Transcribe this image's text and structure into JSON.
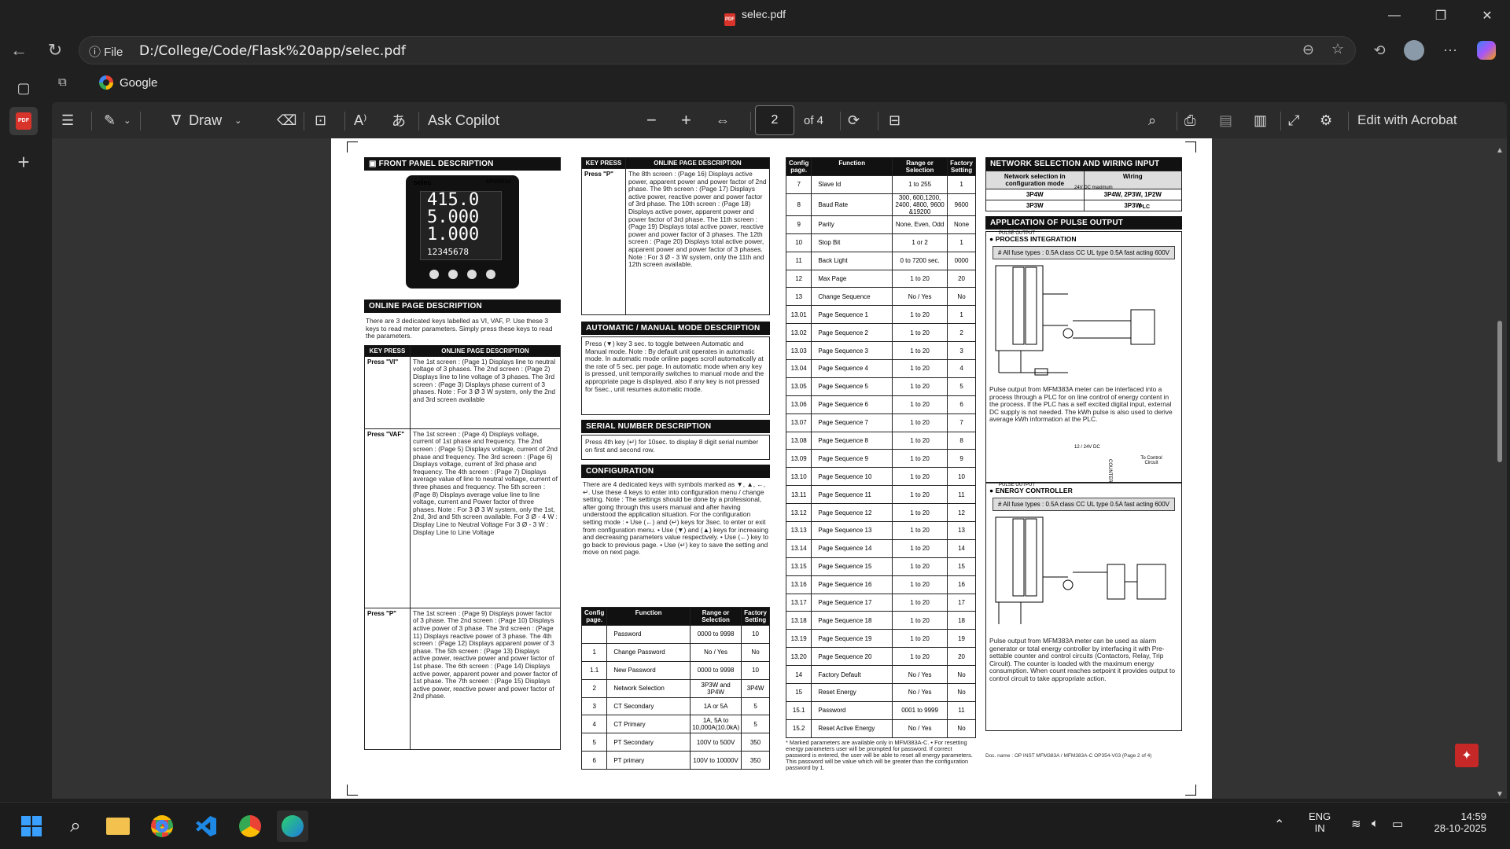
{
  "window": {
    "title": "selec.pdf",
    "controls": [
      "minimize",
      "maximize",
      "close"
    ]
  },
  "addressbar": {
    "info_label": "File",
    "url": "D:/College/Code/Flask%20app/selec.pdf"
  },
  "favorites": {
    "items": [
      {
        "label": "Google"
      }
    ]
  },
  "pdf_toolbar": {
    "draw_label": "Draw",
    "copilot_label": "Ask Copilot",
    "minus": "−",
    "plus": "+",
    "page_current": "2",
    "page_total": "of 4",
    "edit_label": "Edit with Acrobat"
  },
  "doc": {
    "front_panel_header": "FRONT PANEL DESCRIPTION",
    "meter_brand": "selec",
    "meter_model": "MFM383A",
    "meter_lines": [
      "415.0",
      "5.000",
      "1.000",
      "12345678"
    ],
    "online_header": "ONLINE PAGE DESCRIPTION",
    "online_intro": "There are 3 dedicated keys labelled as VI, VAF, P. Use these 3 keys to read meter parameters. Simply press these keys to read the parameters.",
    "key_press_col": "KEY PRESS",
    "online_col": "ONLINE PAGE DESCRIPTION",
    "online_rows": [
      {
        "key": "Press \"VI\"",
        "desc": "The 1st screen : (Page 1) Displays line to neutral voltage of 3 phases. The 2nd screen : (Page 2) Displays line to line voltage of 3 phases. The 3rd screen : (Page 3) Displays phase current of 3 phases. Note : For 3 Ø 3 W system, only the 2nd and 3rd screen available"
      },
      {
        "key": "Press \"VAF\"",
        "desc": "The 1st screen : (Page 4) Displays voltage, current of 1st phase and frequency. The 2nd screen : (Page 5) Displays voltage, current of 2nd phase and frequency. The 3rd screen : (Page 6) Displays voltage, current of 3rd phase and frequency. The 4th screen : (Page 7) Displays average value of line to neutral voltage, current of three phases and frequency. The 5th screen : (Page 8) Displays average value line to line voltage, current and Power factor of three phases. Note : For 3 Ø 3 W system, only the 1st, 2nd, 3rd and 5th screen available. For 3 Ø - 4 W : Display Line to Neutral Voltage For 3 Ø - 3 W : Display Line to Line Voltage"
      },
      {
        "key": "Press \"P\"",
        "desc": "The 1st screen : (Page 9) Displays power factor of 3 phase. The 2nd screen : (Page 10) Displays active power of 3 phase. The 3rd screen : (Page 11) Displays reactive power of 3 phase. The 4th screen : (Page 12) Displays apparent power of 3 phase. The 5th screen : (Page 13) Displays active power, reactive power and power factor of 1st phase. The 6th screen : (Page 14) Displays active power, apparent power and power factor of 1st phase. The 7th screen : (Page 15) Displays active power, reactive power and power factor of 2nd phase."
      }
    ],
    "col2_key_row": {
      "key": "Press \"P\"",
      "desc": "The 8th screen : (Page 16) Displays active power, apparent power and power factor of 2nd phase. The 9th screen : (Page 17) Displays active power, reactive power and power factor of 3rd phase. The 10th screen : (Page 18) Displays active power, apparent power and power factor of 3rd phase. The 11th screen : (Page 19) Displays total active power, reactive power and power factor of 3 phases. The 12th screen : (Page 20) Displays total active power, apparent power and power factor of 3 phases. Note : For 3 Ø - 3 W system, only the 11th and 12th screen available."
    },
    "auto_header": "AUTOMATIC / MANUAL MODE DESCRIPTION",
    "auto_text": "Press (▼) key 3 sec. to toggle between Automatic and Manual mode. Note : By default unit operates in automatic mode. In automatic mode online pages scroll automatically at the rate of 5 sec. per page. In automatic mode when any key is pressed, unit temporarily switches to manual mode and the appropriate page is displayed, also if any key is not pressed for 5sec., unit resumes automatic mode.",
    "serial_header": "SERIAL NUMBER DESCRIPTION",
    "serial_text": "Press 4th key (↵) for 10sec. to display 8 digit serial number on first and second row.",
    "config_header": "CONFIGURATION",
    "config_text": "There are 4 dedicated keys with symbols marked as ▼, ▲, ←, ↵. Use these 4 keys to enter into configuration menu / change setting. Note : The settings should be done by a professional, after going through this users manual and after having understood the application situation. For the configuration setting mode : • Use (←) and (↵) keys for 3sec. to enter or exit from configuration menu. • Use (▼) and (▲) keys for increasing and decreasing parameters value respectively. • Use (←) key to go back to previous page. • Use (↵) key to save the setting and move on next page.",
    "cfg_cols": [
      "Config page.",
      "Function",
      "Range or Selection",
      "Factory Setting"
    ],
    "cfg_rows_a": [
      [
        "",
        "Password",
        "0000 to 9998",
        "10"
      ],
      [
        "1",
        "Change Password",
        "No / Yes",
        "No"
      ],
      [
        "1.1",
        "New Password",
        "0000 to 9998",
        "10"
      ],
      [
        "2",
        "Network Selection",
        "3P3W and 3P4W",
        "3P4W"
      ],
      [
        "3",
        "CT Secondary",
        "1A or 5A",
        "5"
      ],
      [
        "4",
        "CT Primary",
        "1A, 5A to 10,000A(10.0kA)",
        "5"
      ],
      [
        "5",
        "PT Secondary",
        "100V to 500V",
        "350"
      ],
      [
        "6",
        "PT primary",
        "100V to 10000V",
        "350"
      ]
    ],
    "cfg_rows_b": [
      [
        "7",
        "Slave Id",
        "1 to 255",
        "1"
      ],
      [
        "8",
        "Baud Rate",
        "300, 600,1200, 2400, 4800, 9600 &19200",
        "9600"
      ],
      [
        "9",
        "Parity",
        "None, Even, Odd",
        "None"
      ],
      [
        "10",
        "Stop Bit",
        "1 or 2",
        "1"
      ],
      [
        "11",
        "Back Light",
        "0 to 7200 sec.",
        "0000"
      ],
      [
        "12",
        "Max Page",
        "1 to 20",
        "20"
      ],
      [
        "13",
        "Change Sequence",
        "No / Yes",
        "No"
      ],
      [
        "13.01",
        "Page Sequence 1",
        "1 to 20",
        "1"
      ],
      [
        "13.02",
        "Page Sequence 2",
        "1 to 20",
        "2"
      ],
      [
        "13.03",
        "Page Sequence 3",
        "1 to 20",
        "3"
      ],
      [
        "13.04",
        "Page Sequence 4",
        "1 to 20",
        "4"
      ],
      [
        "13.05",
        "Page Sequence 5",
        "1 to 20",
        "5"
      ],
      [
        "13.06",
        "Page Sequence 6",
        "1 to 20",
        "6"
      ],
      [
        "13.07",
        "Page Sequence 7",
        "1 to 20",
        "7"
      ],
      [
        "13.08",
        "Page Sequence 8",
        "1 to 20",
        "8"
      ],
      [
        "13.09",
        "Page Sequence 9",
        "1 to 20",
        "9"
      ],
      [
        "13.10",
        "Page Sequence 10",
        "1 to 20",
        "10"
      ],
      [
        "13.11",
        "Page Sequence 11",
        "1 to 20",
        "11"
      ],
      [
        "13.12",
        "Page Sequence 12",
        "1 to 20",
        "12"
      ],
      [
        "13.13",
        "Page Sequence 13",
        "1 to 20",
        "13"
      ],
      [
        "13.14",
        "Page Sequence 14",
        "1 to 20",
        "14"
      ],
      [
        "13.15",
        "Page Sequence 15",
        "1 to 20",
        "15"
      ],
      [
        "13.16",
        "Page Sequence 16",
        "1 to 20",
        "16"
      ],
      [
        "13.17",
        "Page Sequence 17",
        "1 to 20",
        "17"
      ],
      [
        "13.18",
        "Page Sequence 18",
        "1 to 20",
        "18"
      ],
      [
        "13.19",
        "Page Sequence 19",
        "1 to 20",
        "19"
      ],
      [
        "13.20",
        "Page Sequence 20",
        "1 to 20",
        "20"
      ],
      [
        "14",
        "Factory Default",
        "No / Yes",
        "No"
      ],
      [
        "15",
        "Reset Energy",
        "No / Yes",
        "No"
      ],
      [
        "15.1",
        "Password",
        "0001 to 9999",
        "11"
      ],
      [
        "15.2",
        "Reset Active Energy",
        "No / Yes",
        "No"
      ]
    ],
    "cfg_footnote": "* Marked parameters are available only in MFM383A-C. • For resetting energy parameters user will be prompted for password. If correct password is entered, the user will be able to reset all energy parameters. This password will be value which will be greater than the configuration password by 1.",
    "network_header": "NETWORK SELECTION AND WIRING INPUT",
    "network_cols": [
      "Network selection in configuration mode",
      "Wiring"
    ],
    "network_rows": [
      [
        "3P4W",
        "3P4W, 2P3W, 1P2W"
      ],
      [
        "3P3W",
        "3P3W"
      ]
    ],
    "pulse_header": "APPLICATION OF PULSE OUTPUT",
    "process_title": "PROCESS INTEGRATION",
    "fuse_note": "# All fuse types : 0.5A class CC UL type 0.5A fast acting 600V",
    "dc_label_1": "24V DC maximum",
    "plc_label": "PLC",
    "pulse_out_label": "PULSE OUTPUT",
    "process_text": "Pulse output from MFM383A meter can be interfaced into a process through a PLC for on line control of energy content in the process. If the PLC has a self excited digital input, external DC supply is not needed. The kWh pulse is also used to derive average kWh information at the PLC.",
    "energy_title": "ENERGY CONTROLLER",
    "dc_label_2": "12 / 24V DC",
    "counter_label": "COUNTER",
    "control_label": "To Control Circuit",
    "energy_text": "Pulse output from MFM383A meter can be used as alarm generator or total energy controller by interfacing it with Pre-settable counter and control circuits (Contactors, Relay, Trip Circuit). The counter is loaded with the maximum energy consumption. When count reaches setpoint it provides output to control circuit to take appropriate action.",
    "doc_name": "Doc. name : OP INST MFM383A / MFM383A-C OP354-V03 (Page 2 of 4)"
  },
  "taskbar": {
    "lang_1": "ENG",
    "lang_2": "IN",
    "time": "14:59",
    "date": "28-10-2025"
  },
  "colors": {
    "accent": "#4cc2ff",
    "pdf_red": "#d9342b"
  }
}
